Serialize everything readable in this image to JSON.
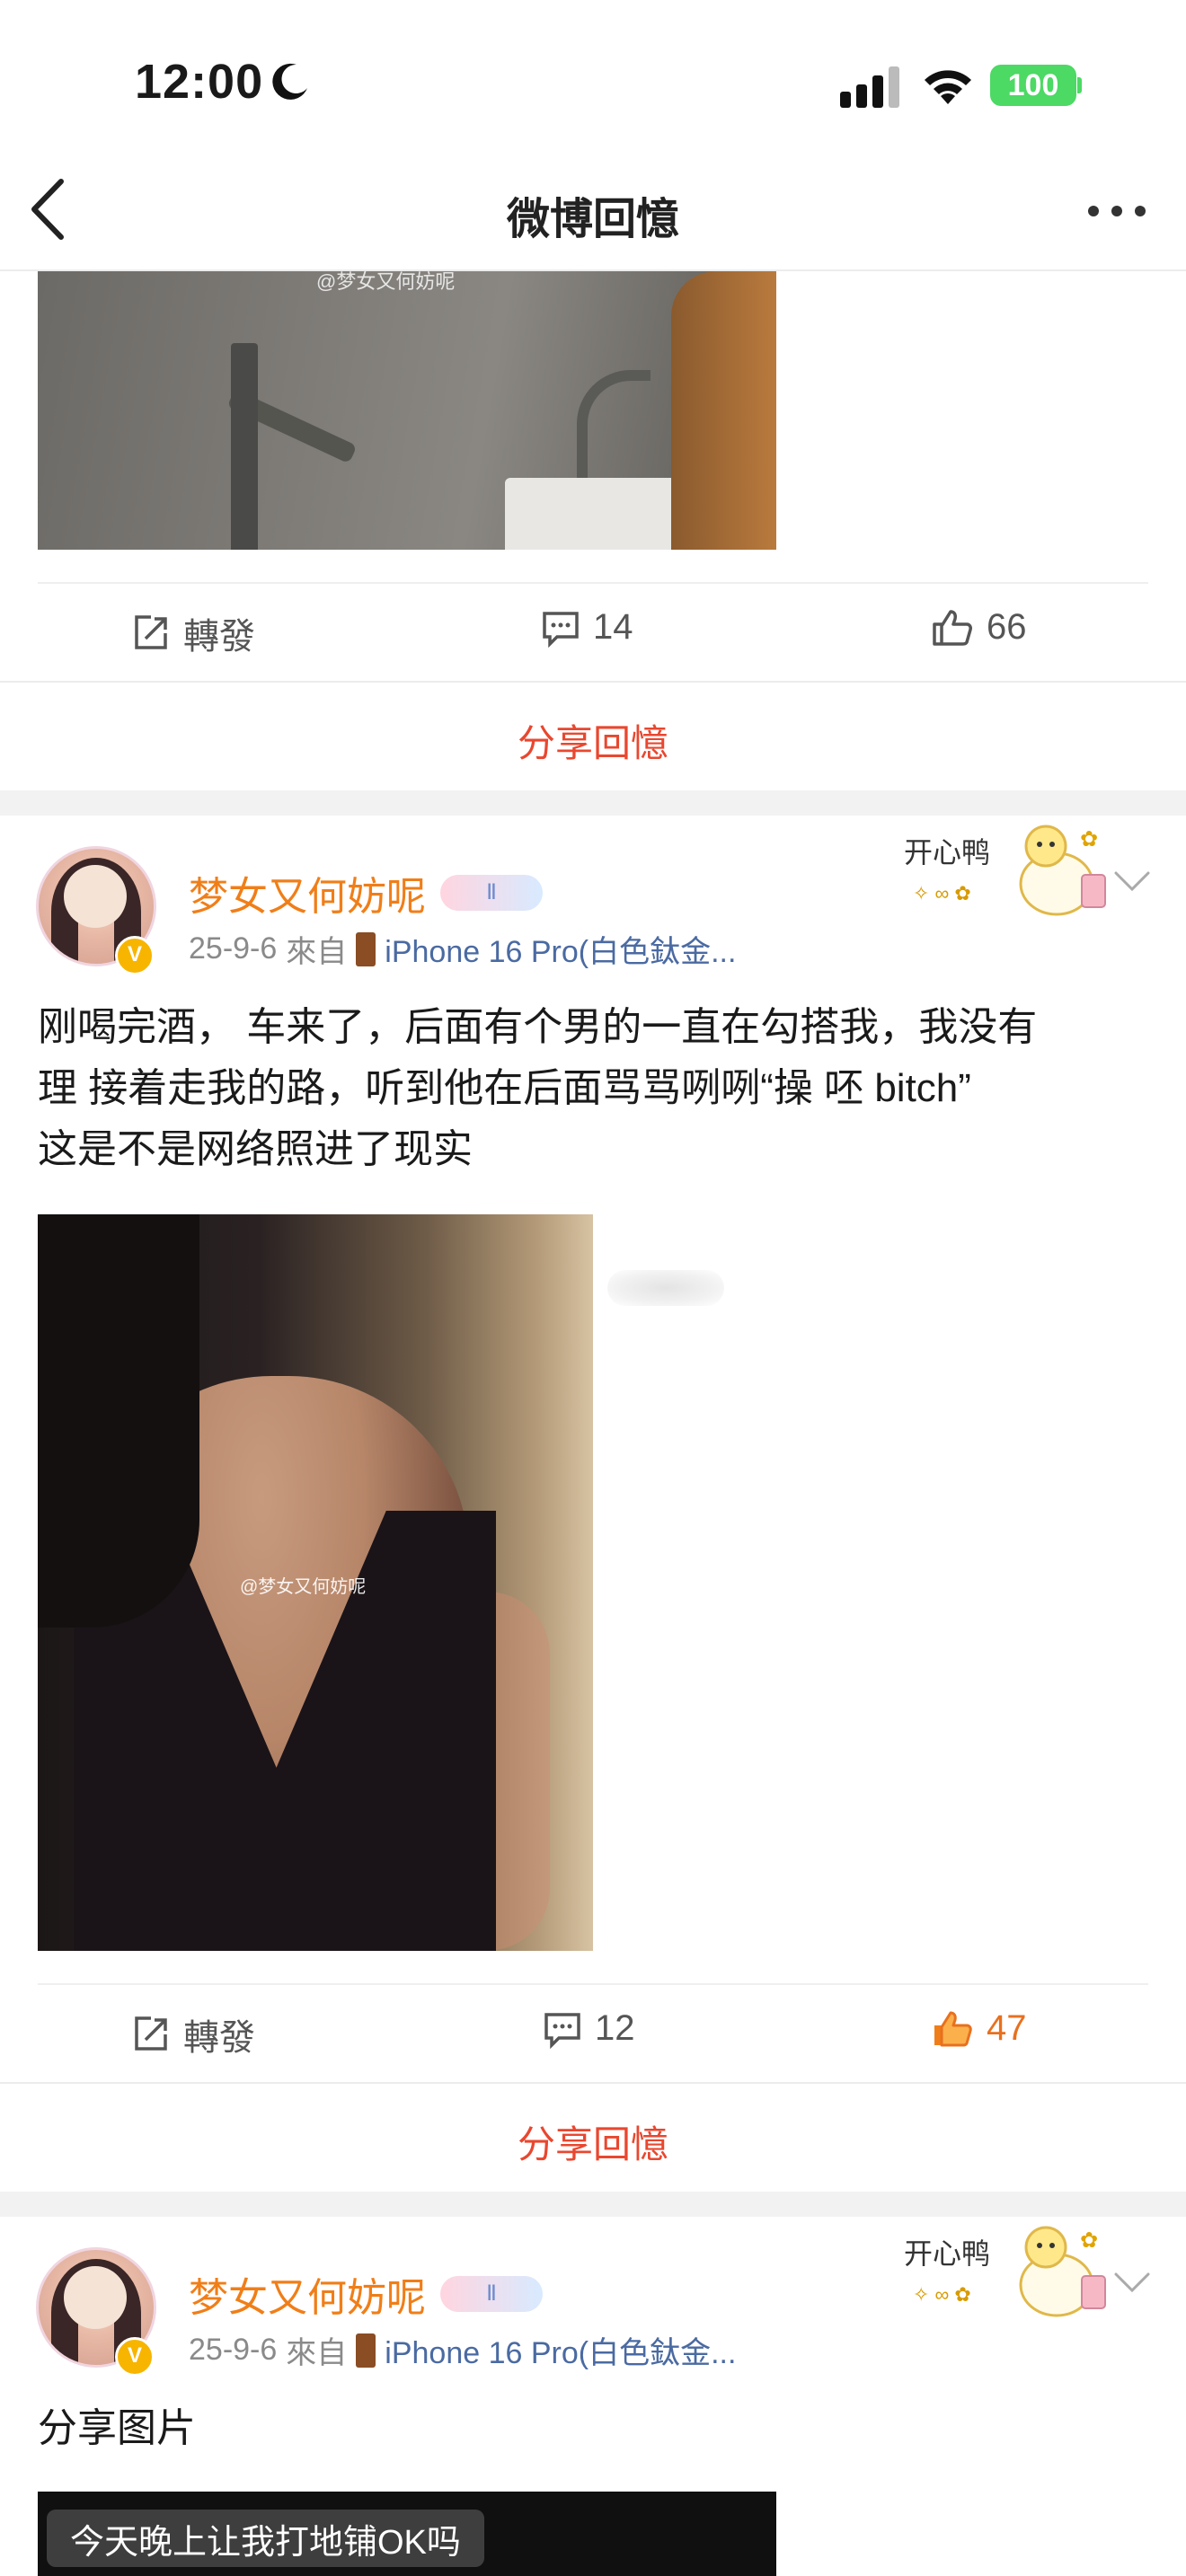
{
  "status_bar": {
    "time": "12:00",
    "battery": "100"
  },
  "nav": {
    "title": "微博回憶"
  },
  "photo_watermark": "@梦女又何妨呢",
  "post_prev": {
    "actions": {
      "repost": "轉發",
      "comments": "14",
      "likes": "66"
    },
    "share_label": "分享回憶"
  },
  "post_main": {
    "username": "梦女又何妨呢",
    "badge": "Ⅱ",
    "verified": "V",
    "date": "25-9-6",
    "from_label": "來自",
    "source": "iPhone 16 Pro(白色鈦金...",
    "sticker_text": "开心鸭",
    "text_lines": [
      "刚喝完酒，  车来了，后面有个男的一直在勾搭我，我没有",
      "理 接着走我的路，听到他在后面骂骂咧咧“操 呸 bitch”",
      "这是不是网络照进了现实"
    ],
    "actions": {
      "repost": "轉發",
      "comments": "12",
      "likes": "47",
      "liked": true
    },
    "share_label": "分享回憶"
  },
  "post_next": {
    "username": "梦女又何妨呢",
    "badge": "Ⅱ",
    "verified": "V",
    "date": "25-9-6",
    "from_label": "來自",
    "source": "iPhone 16 Pro(白色鈦金...",
    "sticker_text": "开心鸭",
    "text": "分享图片",
    "image_caption": "今天晚上让我打地铺OK吗"
  },
  "colors": {
    "accent": "#e9472f",
    "username": "#f07e18",
    "liked": "#e8701e",
    "battery": "#4cd964"
  }
}
